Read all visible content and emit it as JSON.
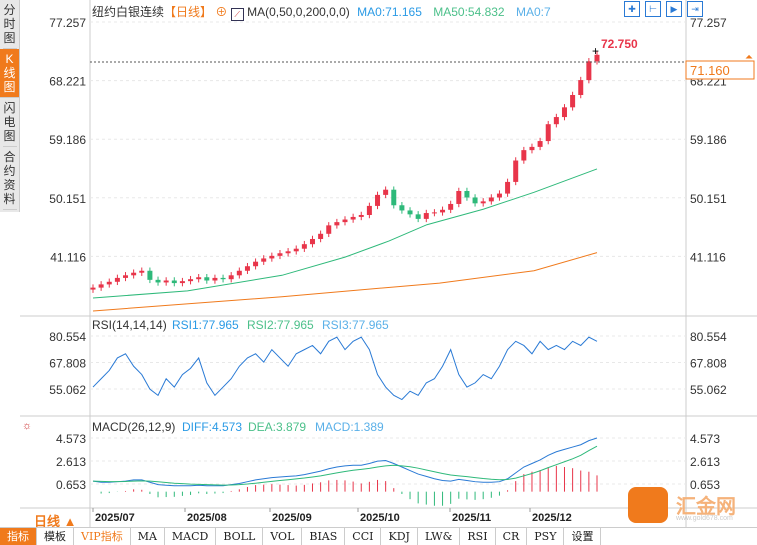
{
  "sidebar": {
    "items": [
      {
        "label": "分时图"
      },
      {
        "label": "K线图",
        "active": true
      },
      {
        "label": "闪电图"
      },
      {
        "label": "合约资料"
      }
    ]
  },
  "header": {
    "title": "纽约白银连续",
    "period": "【日线】",
    "ma_label": "MA(0,50,0,200,0,0)",
    "ma0": "MA0:71.165",
    "ma50": "MA50:54.832",
    "ma0b": "MA0:7"
  },
  "toolbar": {
    "icons": [
      "crosshair-icon",
      "zoom-range-icon",
      "play-range-icon",
      "exit-icon"
    ]
  },
  "price": {
    "high_label": "72.750",
    "last_label": "71.160",
    "axis": [
      "77.257",
      "68.221",
      "59.186",
      "50.151",
      "41.116"
    ]
  },
  "rsi": {
    "label": "RSI(14,14,14)",
    "rsi1": "RSI1:77.965",
    "rsi2": "RSI2:77.965",
    "rsi3": "RSI3:77.965",
    "axis": [
      "80.554",
      "67.808",
      "55.062"
    ]
  },
  "macd": {
    "label": "MACD(26,12,9)",
    "diff": "DIFF:4.573",
    "dea": "DEA:3.879",
    "macd": "MACD:1.389",
    "axis": [
      "4.573",
      "2.613",
      "0.653"
    ]
  },
  "period_button": "日线 ▲",
  "months": [
    "2025/07",
    "2025/08",
    "2025/09",
    "2025/10",
    "2025/11",
    "2025/12"
  ],
  "tabs": [
    "指标",
    "模板",
    "VIP指标",
    "MA",
    "MACD",
    "BOLL",
    "VOL",
    "BIAS",
    "CCI",
    "KDJ",
    "LW&",
    "RSI",
    "CR",
    "PSY",
    "设置"
  ],
  "logo": {
    "text": "汇金网",
    "sub": "www.gold678.com"
  },
  "colors": {
    "up": "#e8354a",
    "down": "#2eb97a",
    "ma50": "#2eb97a",
    "ma200": "#f07a1c",
    "rsi": "#2a7ad5",
    "diff": "#2a7ad5",
    "dea": "#2eb97a",
    "accent": "#f07a1c"
  },
  "chart_data": {
    "type": "candlestick",
    "title": "纽约白银连续",
    "price_ylim": [
      35.0,
      77.257
    ],
    "closes": [
      36.3,
      36.8,
      37.2,
      37.8,
      38.2,
      38.6,
      38.9,
      37.5,
      37.1,
      37.4,
      37.0,
      37.3,
      37.6,
      37.9,
      37.4,
      37.8,
      37.6,
      38.2,
      38.9,
      39.6,
      40.3,
      40.8,
      41.2,
      41.6,
      41.9,
      42.3,
      43.0,
      43.8,
      44.6,
      45.9,
      46.4,
      46.8,
      47.2,
      47.5,
      48.9,
      50.6,
      51.4,
      49.0,
      48.2,
      47.6,
      46.9,
      47.8,
      47.9,
      48.3,
      49.2,
      51.2,
      50.2,
      49.3,
      49.6,
      50.2,
      50.8,
      52.6,
      55.9,
      57.5,
      58.0,
      58.9,
      61.5,
      62.6,
      64.1,
      66.0,
      68.3,
      71.2,
      72.2
    ],
    "ma50": [
      [
        0,
        34.7
      ],
      [
        15,
        35.8
      ],
      [
        30,
        38.2
      ],
      [
        40,
        41.0
      ],
      [
        47,
        43.5
      ],
      [
        53,
        46.0
      ],
      [
        62,
        48.4
      ],
      [
        70,
        51.0
      ],
      [
        80,
        54.6
      ]
    ],
    "ma200": [
      [
        0,
        32.7
      ],
      [
        30,
        34.9
      ],
      [
        55,
        37.0
      ],
      [
        70,
        38.9
      ],
      [
        80,
        41.7
      ]
    ],
    "rsi": [
      56,
      60,
      64,
      70,
      72,
      66,
      62,
      55,
      52,
      60,
      56,
      62,
      65,
      70,
      58,
      52,
      56,
      60,
      66,
      70,
      72,
      68,
      74,
      70,
      66,
      72,
      74,
      76,
      72,
      78,
      80,
      74,
      78,
      80,
      74,
      62,
      56,
      52,
      50,
      54,
      52,
      58,
      60,
      66,
      74,
      62,
      56,
      58,
      62,
      60,
      66,
      74,
      78,
      76,
      72,
      78,
      74,
      76,
      74,
      78,
      76,
      80,
      78
    ],
    "diff": [
      0.9,
      0.8,
      0.8,
      0.85,
      0.9,
      1.0,
      1.0,
      0.8,
      0.6,
      0.55,
      0.5,
      0.5,
      0.5,
      0.55,
      0.5,
      0.5,
      0.5,
      0.6,
      0.7,
      0.85,
      1.0,
      1.1,
      1.2,
      1.25,
      1.3,
      1.35,
      1.45,
      1.6,
      1.75,
      1.95,
      2.1,
      2.2,
      2.25,
      2.25,
      2.4,
      2.6,
      2.65,
      2.4,
      2.1,
      1.8,
      1.5,
      1.3,
      1.1,
      0.95,
      0.9,
      1.05,
      0.95,
      0.85,
      0.8,
      0.8,
      0.85,
      1.1,
      1.6,
      2.1,
      2.4,
      2.7,
      3.1,
      3.4,
      3.6,
      3.8,
      4.0,
      4.35,
      4.573
    ],
    "dea": [
      0.9,
      0.88,
      0.86,
      0.86,
      0.87,
      0.9,
      0.92,
      0.9,
      0.84,
      0.78,
      0.72,
      0.68,
      0.64,
      0.62,
      0.6,
      0.58,
      0.56,
      0.57,
      0.6,
      0.65,
      0.72,
      0.8,
      0.88,
      0.95,
      1.02,
      1.09,
      1.16,
      1.25,
      1.35,
      1.47,
      1.6,
      1.72,
      1.82,
      1.9,
      1.98,
      2.1,
      2.2,
      2.25,
      2.2,
      2.12,
      2.0,
      1.85,
      1.7,
      1.55,
      1.42,
      1.35,
      1.28,
      1.2,
      1.12,
      1.06,
      1.02,
      1.04,
      1.15,
      1.35,
      1.55,
      1.78,
      2.05,
      2.3,
      2.55,
      2.8,
      3.1,
      3.5,
      3.879
    ]
  }
}
